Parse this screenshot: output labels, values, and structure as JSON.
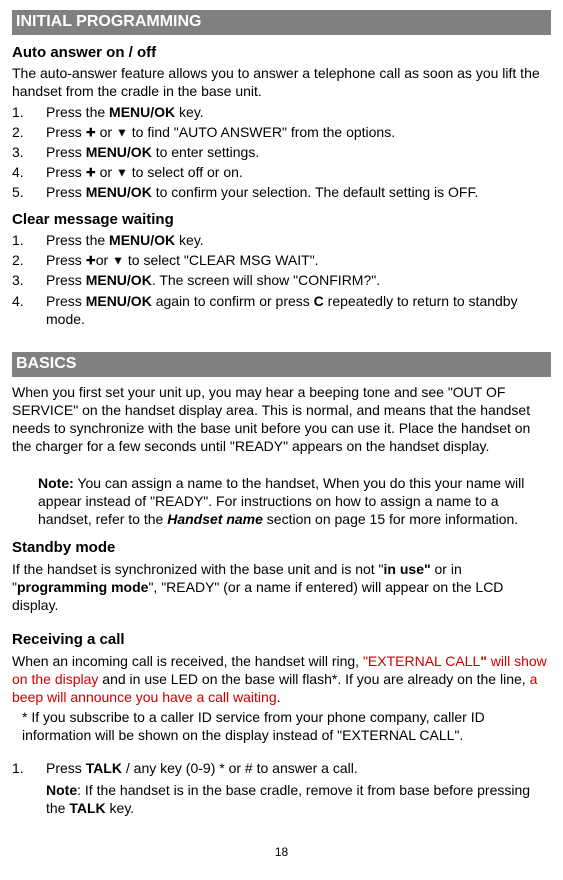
{
  "section1": {
    "title": "INITIAL PROGRAMMING",
    "autoAnswer": {
      "heading": "Auto answer on / off",
      "intro": "The auto-answer feature allows you to answer a telephone call as soon as you lift the handset from the cradle in the base unit.",
      "steps": {
        "n1": "1.",
        "t1a": "Press the ",
        "t1b": "MENU/OK",
        "t1c": " key.",
        "n2": "2.",
        "t2a": "Press ",
        "t2b": " or ",
        "t2c": " to find \"AUTO ANSWER\" from the options.",
        "n3": "3.",
        "t3a": "Press ",
        "t3b": "MENU/OK",
        "t3c": " to enter settings.",
        "n4": "4.",
        "t4a": "Press ",
        "t4b": " or ",
        "t4c": " to select off or on.",
        "n5": "5.",
        "t5a": "Press ",
        "t5b": "MENU/OK",
        "t5c": " to confirm your selection. The default setting is OFF."
      }
    },
    "clearMsg": {
      "heading": "Clear message waiting",
      "steps": {
        "n1": "1.",
        "t1a": "Press the ",
        "t1b": "MENU/OK",
        "t1c": " key.",
        "n2": "2.",
        "t2a": "Press ",
        "t2b": "or ",
        "t2c": " to select \"CLEAR MSG WAIT\".",
        "n3": "3.",
        "t3a": "Press ",
        "t3b": "MENU/OK",
        "t3c": ". The screen will show \"CONFIRM?\".",
        "n4": "4.",
        "t4a": "Press ",
        "t4b": "MENU/OK",
        "t4c": " again to confirm or press ",
        "t4d": "C",
        "t4e": " repeatedly to return to standby mode."
      }
    }
  },
  "section2": {
    "title": "BASICS",
    "intro": "When you first set your unit up, you may hear a beeping tone and see \"OUT OF SERVICE\" on the handset display area. This is normal, and means that the handset needs to synchronize with the base unit before you can use it. Place the handset on the charger for a few seconds until \"READY\" appears on the handset display.",
    "note": {
      "label": "Note:",
      "t1": " You can assign a name to the handset, When you do this your name will appear instead of \"READY\". For instructions on how to assign a name to a handset, refer to the ",
      "t2": "Handset name",
      "t3": " section on page 15 for more information."
    },
    "standby": {
      "heading": "Standby mode",
      "t1": "If the handset is synchronized with the base unit and is not \"",
      "t2": "in use\"",
      "t3": " or in \"",
      "t4": "programming mode",
      "t5": "\", \"READY\" (or a name if entered) will appear on the LCD display."
    },
    "receiving": {
      "heading": "Receiving a call",
      "t1": "When an incoming call is received, the handset will ring,  ",
      "t2": "\"EXTERNAL CALL",
      "t2b": "\"",
      "t2c": " will show on the display",
      "t3": " and in use LED on the base will flash*. If you are already on the line, ",
      "t4": "a beep will announce you have a call waiting",
      "t5": ".",
      "star": "* If you subscribe to a caller ID service from your phone company, caller ID information will be shown on the display instead of \"EXTERNAL CALL\".",
      "step1": {
        "n": "1.",
        "a": "Press ",
        "b": "TALK",
        "c": " / any key (0-9) * or # to answer a call.",
        "noteLabel": "Note",
        "noteA": ": If the handset is in the base cradle, remove it from base before pressing the ",
        "noteB": "TALK",
        "noteC": " key."
      }
    }
  },
  "pageNum": "18",
  "icons": {
    "upCross": "✚",
    "down": "▼"
  }
}
